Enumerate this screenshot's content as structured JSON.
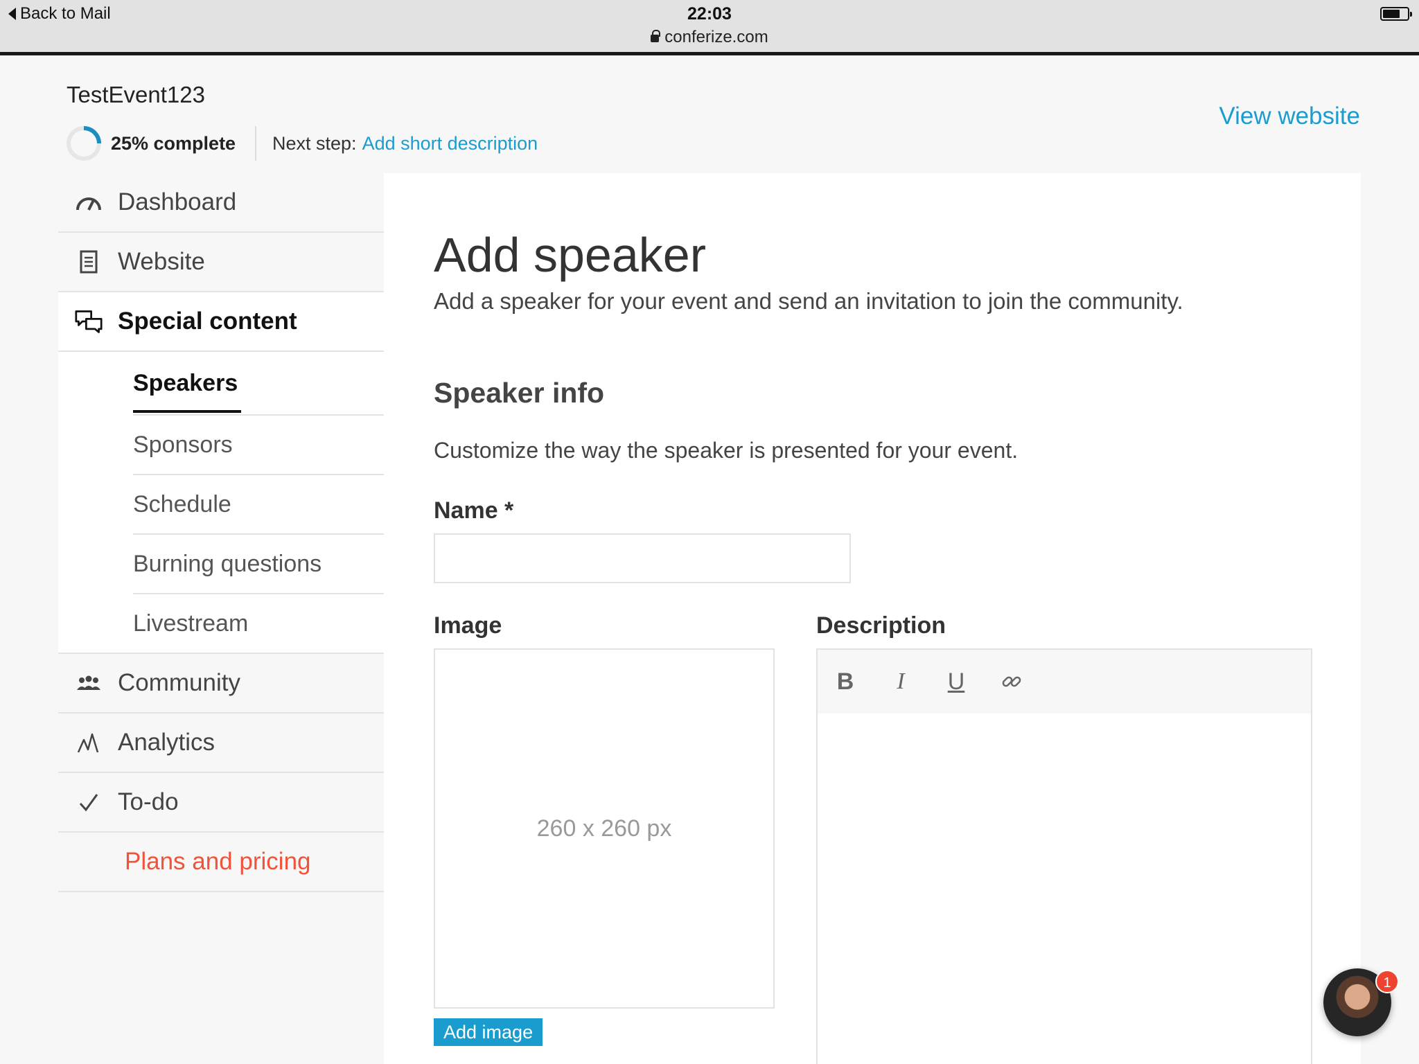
{
  "status_bar": {
    "back_label": "Back to Mail",
    "time": "22:03",
    "url": "conferize.com"
  },
  "header": {
    "event_title": "TestEvent123",
    "progress_label": "25% complete",
    "progress_value": 0.25,
    "next_step_prefix": "Next step:",
    "next_step_link": "Add short description",
    "view_website": "View website"
  },
  "sidebar": {
    "items": [
      {
        "label": "Dashboard",
        "icon": "dashboard-gauge-icon"
      },
      {
        "label": "Website",
        "icon": "document-icon"
      },
      {
        "label": "Special content",
        "icon": "speech-bubbles-icon"
      },
      {
        "label": "Community",
        "icon": "people-icon"
      },
      {
        "label": "Analytics",
        "icon": "analytics-wave-icon"
      },
      {
        "label": "To-do",
        "icon": "checkmark-icon"
      }
    ],
    "sub_items": [
      "Speakers",
      "Sponsors",
      "Schedule",
      "Burning questions",
      "Livestream"
    ],
    "plans_label": "Plans and pricing"
  },
  "main": {
    "title": "Add speaker",
    "subtitle": "Add a speaker for your event and send an invitation to join the community.",
    "section_title": "Speaker info",
    "section_desc": "Customize the way the speaker is presented for your event.",
    "name_label": "Name *",
    "name_value": "",
    "image_label": "Image",
    "image_placeholder": "260 x 260 px",
    "add_image_label": "Add image",
    "description_label": "Description",
    "toolbar": {
      "bold": "B",
      "italic": "I",
      "underline": "U"
    }
  },
  "chat": {
    "badge_count": "1"
  },
  "colors": {
    "accent": "#1a9ccf",
    "plans": "#f0533a",
    "badge": "#f0432f"
  }
}
